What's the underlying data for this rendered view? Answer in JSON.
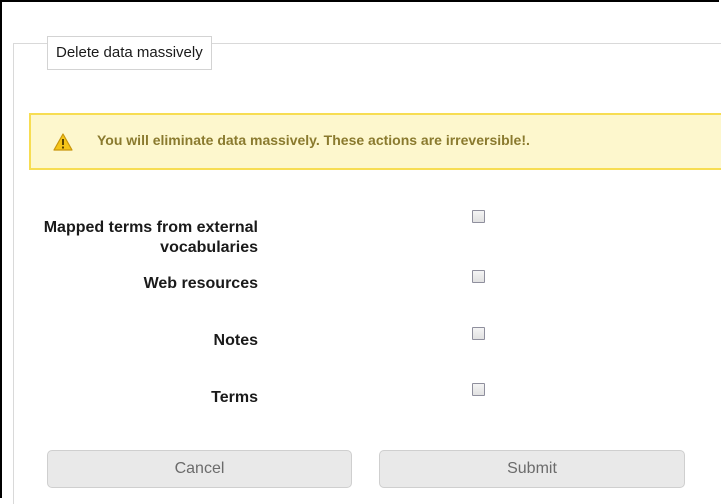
{
  "form": {
    "legend": "Delete data massively"
  },
  "warning": {
    "icon": "warning-triangle-icon",
    "text": "You will eliminate data massively. These actions are irreversible!."
  },
  "options": [
    {
      "label": "Mapped terms from external vocabularies",
      "checked": false
    },
    {
      "label": "Web resources",
      "checked": false
    },
    {
      "label": "Notes",
      "checked": false
    },
    {
      "label": "Terms",
      "checked": false
    }
  ],
  "buttons": {
    "cancel": "Cancel",
    "submit": "Submit"
  },
  "colors": {
    "warning_bg": "#fdf7cd",
    "warning_border": "#f7dd52",
    "warning_text": "#8a7a2e",
    "button_bg": "#e9e9e9"
  }
}
